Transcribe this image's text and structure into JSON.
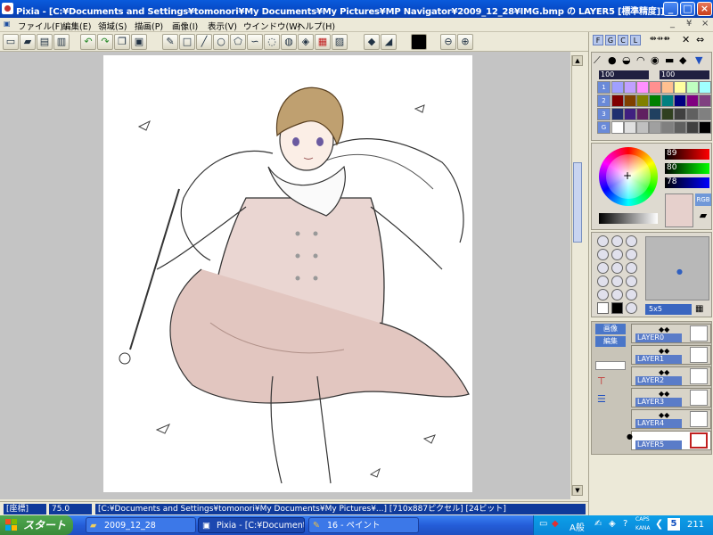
{
  "window": {
    "title": "Pixia - [C:¥Documents and Settings¥tomonori¥My Documents¥My Pictures¥MP Navigator¥2009_12_28¥IMG.bmp の LAYER5 [標準精度]]",
    "controls": {
      "minimize": "_",
      "maximize": "□",
      "close": "×"
    }
  },
  "menu": {
    "items": [
      "ファイル(F)",
      "編集(E)",
      "領域(S)",
      "描画(P)",
      "画像(I)",
      "表示(V)",
      "ウインドウ(W)",
      "ヘルプ(H)"
    ],
    "right": [
      "_",
      "¥",
      "×"
    ]
  },
  "toolbar": {
    "icons": [
      "new-icon",
      "open-icon",
      "save-icon",
      "print-icon",
      "undo-icon",
      "redo-icon",
      "copy-icon",
      "paste-icon",
      "pen-icon",
      "rect-icon",
      "line-icon",
      "circle-icon",
      "polygon-icon",
      "curve-icon",
      "lasso-icon",
      "bucket-icon",
      "gradient-icon",
      "grid-icon",
      "eraser-icon",
      "smudge-icon",
      "color-icon",
      "zoom-out-icon",
      "zoom-in-icon"
    ]
  },
  "status": {
    "coord_label": "[座標]",
    "zoom": "75.0",
    "path": "[C:¥Documents and Settings¥tomonori¥My Documents¥My Pictures¥...] [710x887ピクセル] [24ビット]"
  },
  "right_panel": {
    "top_buttons": [
      "F",
      "G",
      "C",
      "L"
    ],
    "opacity1": "100",
    "opacity2": "100",
    "palette_rows": [
      "1",
      "2",
      "3",
      "G"
    ],
    "rgb": {
      "r": "89",
      "g": "80",
      "b": "78"
    },
    "rgb_button": "RGB",
    "brush_size": "5x5",
    "layer_buttons": [
      "画像",
      "編集"
    ],
    "layers": [
      "LAYER0",
      "LAYER1",
      "LAYER2",
      "LAYER3",
      "LAYER4",
      "LAYER5"
    ]
  },
  "taskbar": {
    "start": "スタート",
    "tasks": [
      "2009_12_28",
      "Pixia - [C:¥Document...",
      "16 - ペイント"
    ],
    "tray_ime": "A般",
    "caps": "CAPS",
    "kana": "KANA",
    "clock": "211"
  },
  "colors": {
    "accent": "#0a5bdc",
    "status_bg": "#0f3a9a",
    "taskbar": "#245dd8",
    "start": "#3a8a3a"
  }
}
